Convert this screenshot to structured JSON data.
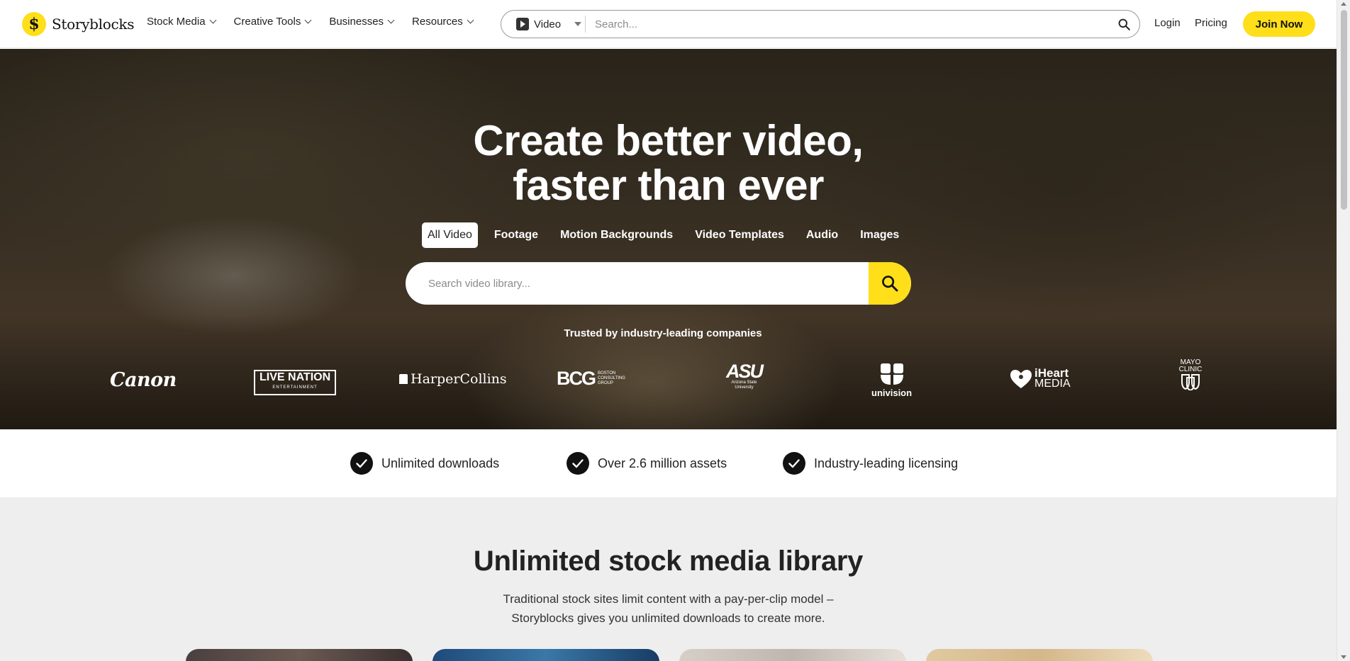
{
  "brand": {
    "name": "Storyblocks",
    "accent_color": "#ffde1a"
  },
  "nav": {
    "items": [
      {
        "label": "Stock Media"
      },
      {
        "label": "Creative Tools"
      },
      {
        "label": "Businesses"
      },
      {
        "label": "Resources"
      }
    ]
  },
  "top_search": {
    "type_label": "Video",
    "placeholder": "Search...",
    "icon": "search-icon"
  },
  "header_links": {
    "login": "Login",
    "pricing": "Pricing",
    "join": "Join Now"
  },
  "hero": {
    "title_line1": "Create better video,",
    "title_line2": "faster than ever",
    "tabs": [
      {
        "label": "All Video",
        "active": true
      },
      {
        "label": "Footage",
        "active": false
      },
      {
        "label": "Motion Backgrounds",
        "active": false
      },
      {
        "label": "Video Templates",
        "active": false
      },
      {
        "label": "Audio",
        "active": false
      },
      {
        "label": "Images",
        "active": false
      }
    ],
    "search_placeholder": "Search video library...",
    "trusted": "Trusted by industry-leading companies",
    "logos": {
      "canon": "Canon",
      "live_nation": "LIVE NATION",
      "live_nation_sub": "ENTERTAINMENT",
      "harper": "HarperCollins",
      "bcg": "BCG",
      "bcg_sub": "BOSTON CONSULTING GROUP",
      "asu": "ASU",
      "asu_sub": "Arizona State University",
      "univision": "univision",
      "iheart": "iHeart",
      "iheart_sub": "MEDIA",
      "mayo": "MAYO CLINIC"
    }
  },
  "features": [
    {
      "label": "Unlimited downloads"
    },
    {
      "label": "Over 2.6 million assets"
    },
    {
      "label": "Industry-leading licensing"
    }
  ],
  "library": {
    "title": "Unlimited stock media library",
    "desc_line1": "Traditional stock sites limit content with a pay-per-clip model –",
    "desc_line2": "Storyblocks gives you unlimited downloads to create more."
  }
}
